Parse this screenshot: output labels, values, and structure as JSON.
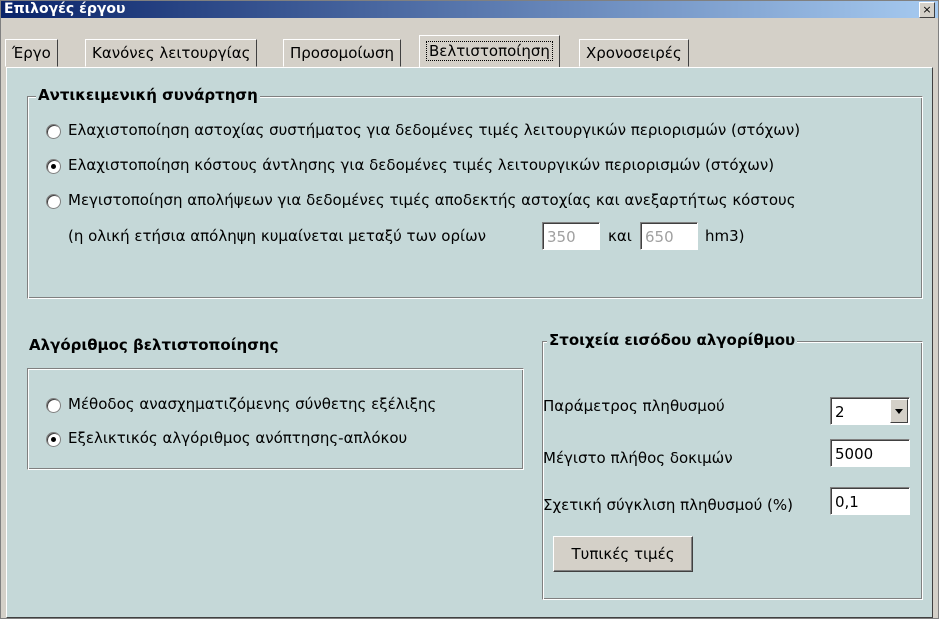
{
  "window": {
    "title": "Επιλογές έργου",
    "close_glyph": "×"
  },
  "tabs": [
    {
      "label": "Έργο"
    },
    {
      "label": "Κανόνες λειτουργίας"
    },
    {
      "label": "Προσομοίωση"
    },
    {
      "label": "Βελτιστοποίηση",
      "active": true
    },
    {
      "label": "Χρονοσειρές"
    }
  ],
  "objective": {
    "title": "Αντικειμενική συνάρτηση",
    "options": [
      {
        "label": "Ελαχιστοποίηση αστοχίας συστήματος για δεδομένες τιμές λειτουργικών περιορισμών (στόχων)",
        "selected": false
      },
      {
        "label": "Ελαχιστοποίηση κόστους άντλησης για δεδομένες τιμές λειτουργικών περιορισμών (στόχων)",
        "selected": true
      },
      {
        "label": "Μεγιστοποίηση απολήψεων για δεδομένες τιμές αποδεκτής αστοχίας και ανεξαρτήτως κόστους",
        "selected": false
      }
    ],
    "range_text_prefix": "(η ολική ετήσια απόληψη κυμαίνεται μεταξύ των ορίων",
    "range_min": "350",
    "range_and": "και",
    "range_max": "650",
    "range_unit": "hm3)"
  },
  "algorithm": {
    "title": "Αλγόριθμος βελτιστοποίησης",
    "options": [
      {
        "label": "Μέθοδος ανασχηματιζόμενης σύνθετης εξέλιξης",
        "selected": false
      },
      {
        "label": "Εξελικτικός αλγόριθμος ανόπτησης-απλόκου",
        "selected": true
      }
    ]
  },
  "inputs": {
    "title": "Στοιχεία εισόδου αλγορίθμου",
    "population_param_label": "Παράμετρος πληθυσμού",
    "population_param_value": "2",
    "max_trials_label": "Μέγιστο πλήθος δοκιμών",
    "max_trials_value": "5000",
    "convergence_label": "Σχετική σύγκλιση πληθυσμού (%)",
    "convergence_value": "0,1",
    "defaults_button": "Τυπικές τιμές"
  }
}
